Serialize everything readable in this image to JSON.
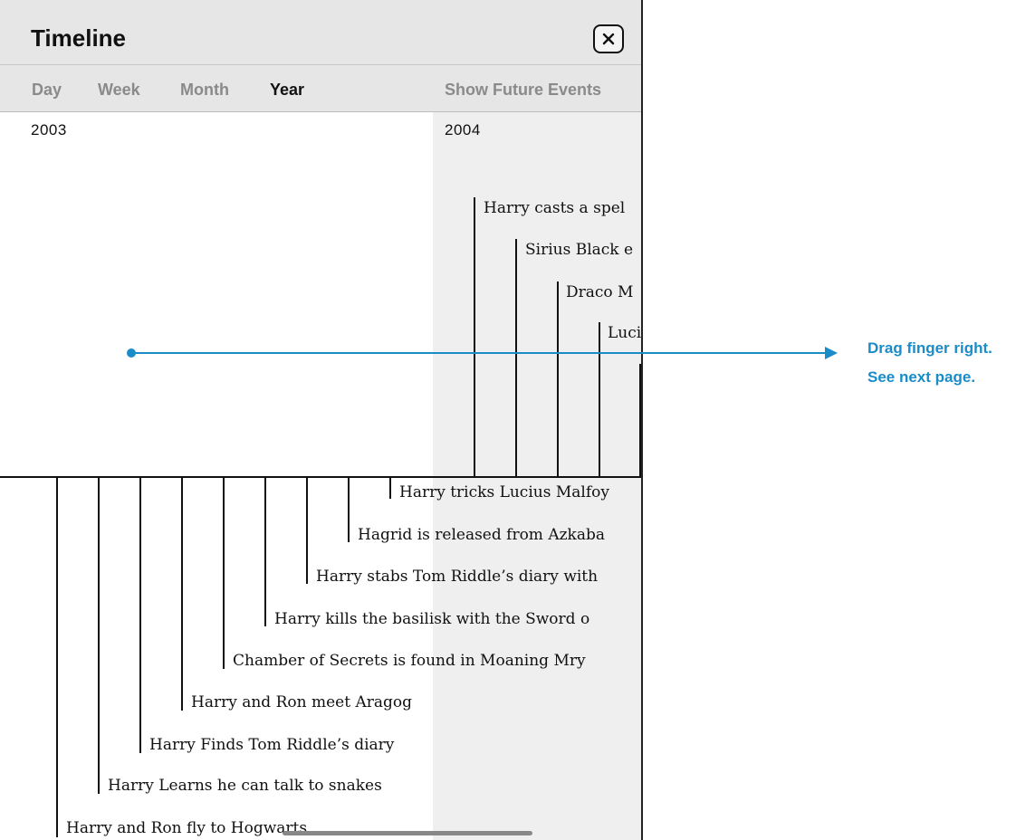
{
  "header": {
    "title": "Timeline",
    "close_icon": "close-x-icon"
  },
  "tabs": [
    {
      "label": "Day",
      "active": false
    },
    {
      "label": "Week",
      "active": false
    },
    {
      "label": "Month",
      "active": false
    },
    {
      "label": "Year",
      "active": true
    }
  ],
  "show_future_label": "Show Future Events",
  "timeline": {
    "years": [
      "2003",
      "2004"
    ],
    "events_above": [
      {
        "label": "Harry casts a spel"
      },
      {
        "label": "Sirius Black e"
      },
      {
        "label": "Draco M"
      },
      {
        "label": "Luci"
      }
    ],
    "events_below": [
      {
        "label": "Harry  tricks Lucius Malfoy"
      },
      {
        "label": "Hagrid is released from Azkaba"
      },
      {
        "label": "Harry stabs Tom Riddle’s diary with"
      },
      {
        "label": "Harry kills the basilisk with the Sword o"
      },
      {
        "label": "Chamber of Secrets is found in Moaning Mry"
      },
      {
        "label": "Harry and Ron meet Aragog"
      },
      {
        "label": "Harry Finds Tom Riddle’s diary"
      },
      {
        "label": "Harry Learns he can talk to snakes"
      },
      {
        "label": "Harry and Ron fly to Hogwarts"
      }
    ]
  },
  "instruction": {
    "line1": "Drag finger right.",
    "line2": "See next page."
  },
  "colors": {
    "accent": "#1a8cc8",
    "future_shade": "#efefef",
    "header_bg": "#e6e6e6"
  }
}
